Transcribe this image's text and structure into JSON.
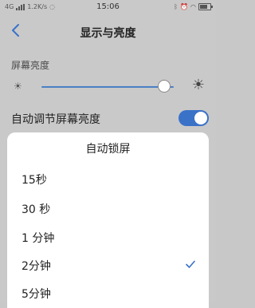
{
  "status_bar": {
    "network": "4G",
    "speed": "1.2K/s",
    "time": "15:06"
  },
  "header": {
    "title": "显示与亮度"
  },
  "brightness": {
    "section_label": "屏幕亮度",
    "level": 0.93
  },
  "auto_brightness": {
    "label": "自动调节屏幕亮度",
    "enabled": true
  },
  "sheet": {
    "title": "自动锁屏",
    "options": [
      {
        "label": "15秒",
        "selected": false
      },
      {
        "label": "30 秒",
        "selected": false
      },
      {
        "label": "1 分钟",
        "selected": false
      },
      {
        "label": "2分钟",
        "selected": true
      },
      {
        "label": "5分钟",
        "selected": false
      }
    ]
  },
  "colors": {
    "accent": "#3a72c8",
    "dim_background": "#c9c9c9",
    "sheet_background": "#ffffff"
  }
}
